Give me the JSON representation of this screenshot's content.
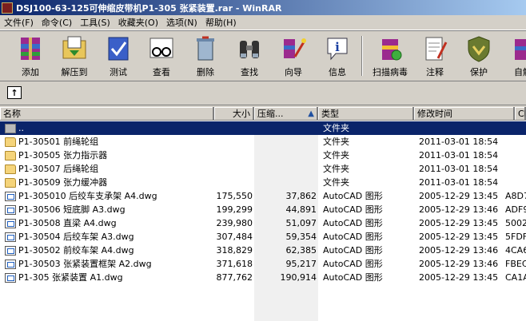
{
  "window": {
    "title": "DSJ100-63-125可伸缩皮带机P1-305 张紧装置.rar - WinRAR"
  },
  "menu": [
    "文件(F)",
    "命令(C)",
    "工具(S)",
    "收藏夹(O)",
    "选项(N)",
    "帮助(H)"
  ],
  "toolbar": {
    "add": "添加",
    "extract": "解压到",
    "test": "测试",
    "view": "查看",
    "delete": "删除",
    "find": "查找",
    "wizard": "向导",
    "info": "信息",
    "virusscan": "扫描病毒",
    "comment": "注释",
    "protect": "保护",
    "sfx": "自解"
  },
  "columns": {
    "name": "名称",
    "size": "大小",
    "packed": "压缩...",
    "type": "类型",
    "modified": "修改时间",
    "crc": "CR"
  },
  "files": [
    {
      "icon": "up-folder",
      "name": "..",
      "size": "",
      "packed": "",
      "type": "文件夹",
      "modified": "",
      "crc": ""
    },
    {
      "icon": "folder",
      "name": "P1-30501 前绳轮组",
      "size": "",
      "packed": "",
      "type": "文件夹",
      "modified": "2011-03-01 18:54",
      "crc": ""
    },
    {
      "icon": "folder",
      "name": "P1-30505 张力指示器",
      "size": "",
      "packed": "",
      "type": "文件夹",
      "modified": "2011-03-01 18:54",
      "crc": ""
    },
    {
      "icon": "folder",
      "name": "P1-30507 后绳轮组",
      "size": "",
      "packed": "",
      "type": "文件夹",
      "modified": "2011-03-01 18:54",
      "crc": ""
    },
    {
      "icon": "folder",
      "name": "P1-30509 张力缓冲器",
      "size": "",
      "packed": "",
      "type": "文件夹",
      "modified": "2011-03-01 18:54",
      "crc": ""
    },
    {
      "icon": "dwg",
      "name": "P1-305010 后绞车支承架 A4.dwg",
      "size": "175,550",
      "packed": "37,862",
      "type": "AutoCAD 图形",
      "modified": "2005-12-29 13:45",
      "crc": "A8D7"
    },
    {
      "icon": "dwg",
      "name": "P1-30506 短底脚 A3.dwg",
      "size": "199,299",
      "packed": "44,891",
      "type": "AutoCAD 图形",
      "modified": "2005-12-29 13:46",
      "crc": "ADF9"
    },
    {
      "icon": "dwg",
      "name": "P1-30508 直梁 A4.dwg",
      "size": "239,980",
      "packed": "51,097",
      "type": "AutoCAD 图形",
      "modified": "2005-12-29 13:45",
      "crc": "5002"
    },
    {
      "icon": "dwg",
      "name": "P1-30504 后绞车架 A3.dwg",
      "size": "307,484",
      "packed": "59,354",
      "type": "AutoCAD 图形",
      "modified": "2005-12-29 13:45",
      "crc": "5FDF"
    },
    {
      "icon": "dwg",
      "name": "P1-30502 前绞车架 A4.dwg",
      "size": "318,829",
      "packed": "62,385",
      "type": "AutoCAD 图形",
      "modified": "2005-12-29 13:46",
      "crc": "4CA6"
    },
    {
      "icon": "dwg",
      "name": "P1-30503 张紧装置框架 A2.dwg",
      "size": "371,618",
      "packed": "95,217",
      "type": "AutoCAD 图形",
      "modified": "2005-12-29 13:46",
      "crc": "FBEC"
    },
    {
      "icon": "dwg",
      "name": "P1-305 张紧装置 A1.dwg",
      "size": "877,762",
      "packed": "190,914",
      "type": "AutoCAD 图形",
      "modified": "2005-12-29 13:45",
      "crc": "CA1A"
    }
  ]
}
